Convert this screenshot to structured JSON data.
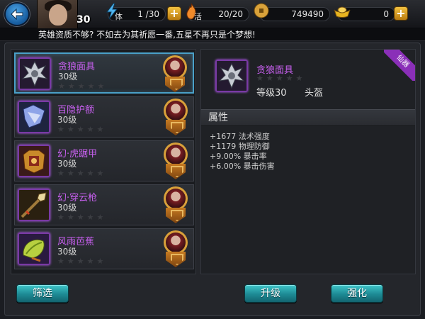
{
  "header": {
    "player_level": "30",
    "stamina_label": "体",
    "stamina_value": "1 /30",
    "vitality_label": "活",
    "vitality_value": "20/20",
    "coins_value": "749490",
    "ingots_value": "0",
    "plus_symbol": "+"
  },
  "message": "英雄资质不够? 不如去为其祈愿一番,五星不再只是个梦想!",
  "items": [
    {
      "name": "贪狼面具",
      "level": "30级",
      "stars": "★★★★★",
      "selected": true
    },
    {
      "name": "百隐护额",
      "level": "30级",
      "stars": "★★★★★",
      "selected": false
    },
    {
      "name": "幻·虎踞甲",
      "level": "30级",
      "stars": "★★★★★",
      "selected": false
    },
    {
      "name": "幻·穿云枪",
      "level": "30级",
      "stars": "★★★★★",
      "selected": false
    },
    {
      "name": "风雨芭蕉",
      "level": "30级",
      "stars": "★★★★★",
      "selected": false
    }
  ],
  "detail": {
    "name": "贪狼面具",
    "stars": "★★★★★",
    "level": "等级30",
    "slot": "头盔",
    "ribbon": "仙器",
    "attr_header": "属性",
    "attributes": [
      "+1677 法术强度",
      "+1179 物理防御",
      "+9.00% 暴击率",
      "+6.00% 暴击伤害"
    ]
  },
  "buttons": {
    "filter": "筛选",
    "upgrade": "升级",
    "enhance": "强化"
  },
  "colors": {
    "item_name": "#c860f0",
    "button_teal": "#1d8a94",
    "selection_border": "#4aa0c8"
  }
}
